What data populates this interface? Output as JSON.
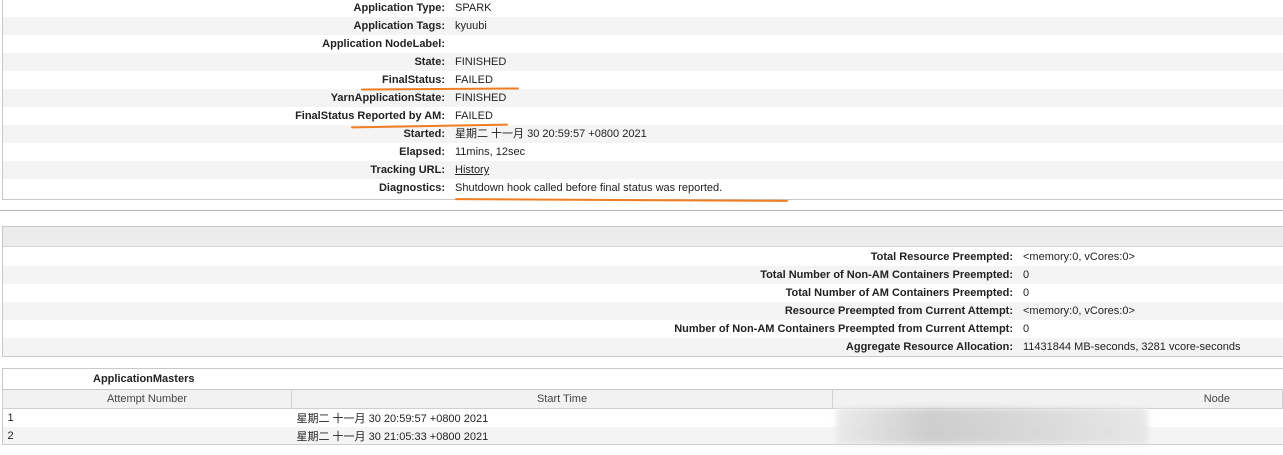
{
  "overview": {
    "rows": [
      {
        "label": "Application Type:",
        "value": "SPARK"
      },
      {
        "label": "Application Tags:",
        "value": "kyuubi"
      },
      {
        "label": "Application NodeLabel:",
        "value": ""
      },
      {
        "label": "State:",
        "value": "FINISHED"
      },
      {
        "label": "FinalStatus:",
        "value": "FAILED"
      },
      {
        "label": "YarnApplicationState:",
        "value": "FINISHED"
      },
      {
        "label": "FinalStatus Reported by AM:",
        "value": "FAILED"
      },
      {
        "label": "Started:",
        "value": "星期二 十一月 30 20:59:57 +0800 2021"
      },
      {
        "label": "Elapsed:",
        "value": "11mins, 12sec"
      },
      {
        "label": "Tracking URL:",
        "value": "History"
      },
      {
        "label": "Diagnostics:",
        "value": "Shutdown hook called before final status was reported."
      }
    ]
  },
  "metrics": {
    "rows": [
      {
        "label": "Total Resource Preempted:",
        "value": "<memory:0, vCores:0>"
      },
      {
        "label": "Total Number of Non-AM Containers Preempted:",
        "value": "0"
      },
      {
        "label": "Total Number of AM Containers Preempted:",
        "value": "0"
      },
      {
        "label": "Resource Preempted from Current Attempt:",
        "value": "<memory:0, vCores:0>"
      },
      {
        "label": "Number of Non-AM Containers Preempted from Current Attempt:",
        "value": "0"
      },
      {
        "label": "Aggregate Resource Allocation:",
        "value": "11431844 MB-seconds, 3281 vcore-seconds"
      }
    ]
  },
  "app_masters": {
    "title": "ApplicationMasters",
    "columns": [
      "Attempt Number",
      "Start Time",
      "Node"
    ],
    "rows": [
      {
        "attempt": "1",
        "start": "星期二 十一月 30 20:59:57 +0800 2021"
      },
      {
        "attempt": "2",
        "start": "星期二 十一月 30 21:05:33 +0800 2021"
      }
    ]
  },
  "annotation_color": "#ef7d22"
}
